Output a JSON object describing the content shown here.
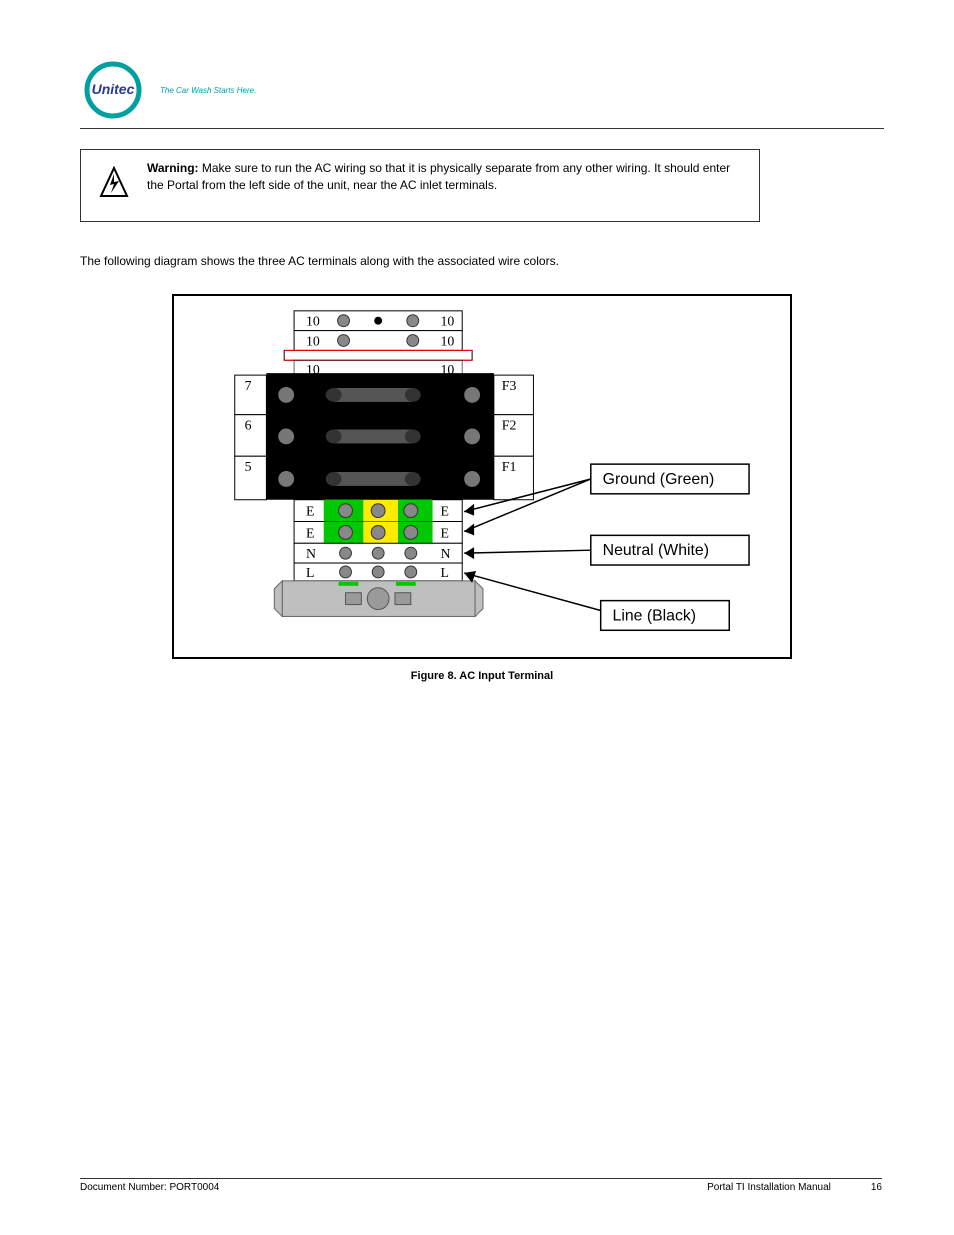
{
  "logo": {
    "text": "Unitec"
  },
  "tagline": "The Car Wash Starts Here.",
  "warning": {
    "heading": "Warning:",
    "body": "Make sure to run the AC wiring so that it is physically separate from any other wiring. It should enter the Portal from the left side of the unit, near the AC inlet terminals."
  },
  "para1": "The following diagram shows the three AC terminals along with the associated wire colors.",
  "figure": {
    "top_rows": [
      "10",
      "10",
      "10"
    ],
    "fuse_rows": [
      {
        "left": "7",
        "right": "F3"
      },
      {
        "left": "6",
        "right": "F2"
      },
      {
        "left": "5",
        "right": "F1"
      }
    ],
    "term_rows": [
      {
        "left": "E",
        "right": "E"
      },
      {
        "left": "E",
        "right": "E"
      },
      {
        "left": "N",
        "right": "N"
      },
      {
        "left": "L",
        "right": "L"
      }
    ],
    "callouts": {
      "ground": "Ground (Green)",
      "neutral": "Neutral (White)",
      "line": "Line (Black)"
    },
    "caption": "Figure 8. AC Input Terminal"
  },
  "footer": {
    "left_text": "Document Number",
    "left_code": "PORT0004",
    "center": "Portal TI Installation Manual",
    "right": "16"
  }
}
